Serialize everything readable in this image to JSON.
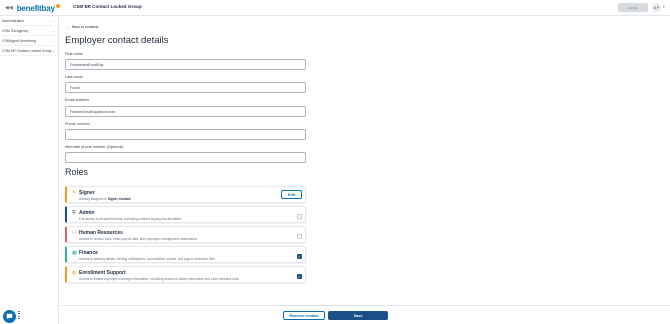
{
  "header": {
    "logo_text": "benefitbay",
    "group_title": "CSM ER Contact Locked Group",
    "apply_label": "Apply",
    "avatar_initials": "A P",
    "collapse_icon": "double-chevron-left-icon"
  },
  "sidebar": {
    "items": [
      {
        "label": "Administration"
      },
      {
        "label": "CSM GA Agency"
      },
      {
        "label": "CSMAgent Armstrong"
      },
      {
        "label": "CSM ER Contact Locked Group"
      }
    ]
  },
  "main": {
    "back_label": "Back to contacts",
    "page_title": "Employer contact details",
    "fields": {
      "first_name": {
        "label": "First name",
        "value": "FinanceandEnrollSup"
      },
      "last_name": {
        "label": "Last name",
        "value": "Functi"
      },
      "email": {
        "label": "Email address",
        "value": "FinanceEnrollSup@com.com"
      },
      "phone": {
        "label": "Phone number",
        "value": ""
      },
      "alt_phone": {
        "label": "Alternate phone number (Optional)",
        "value": ""
      }
    },
    "roles_title": "Roles",
    "roles": [
      {
        "name": "Signer",
        "desc_prefix": "Already assigned to",
        "desc_bold": "Signer Contact",
        "icon": "pen-icon",
        "accent": "#f29b1d",
        "action": "Edit"
      },
      {
        "name": "Admin",
        "desc": "Full access to all system areas, excluding contract signing functionalities.",
        "icon": "shield-icon",
        "accent": "#1b4f8a",
        "checked": false
      },
      {
        "name": "Human Resources",
        "desc": "Access to census tools, basic payroll data, and employee management dashboards.",
        "icon": "people-icon",
        "accent": "#e0625f",
        "checked": false
      },
      {
        "name": "Finance",
        "desc": "Access to banking details, funding notifications, reconciliation reports, and payroll deduction files.",
        "icon": "calculator-icon",
        "accent": "#2fb39a",
        "checked": true
      },
      {
        "name": "Enrollment Support",
        "desc": "Access to limited employee coverage information, excluding access to salary information and other sensitive data.",
        "icon": "support-icon",
        "accent": "#f29b1d",
        "checked": true
      }
    ]
  },
  "footer": {
    "remove_label": "Remove contact",
    "save_label": "Save"
  },
  "colors": {
    "primary": "#1b4f8a",
    "link": "#0a6fb0"
  }
}
